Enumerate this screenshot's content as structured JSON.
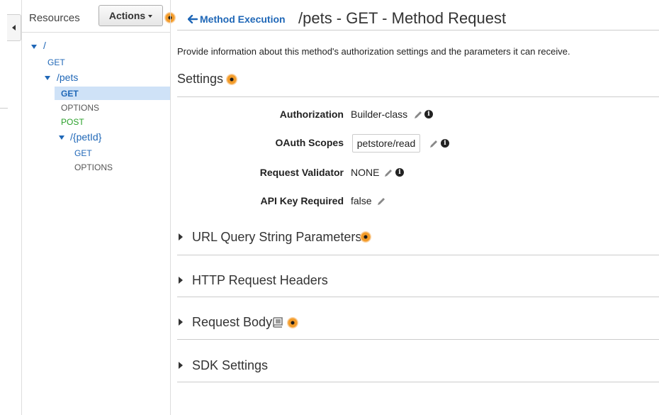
{
  "resources": {
    "title": "Resources",
    "actions_label": "Actions",
    "tree": {
      "root_path": "/",
      "root_get": "GET",
      "pets_path": "/pets",
      "pets_get": "GET",
      "pets_options": "OPTIONS",
      "pets_post": "POST",
      "petid_path": "/{petId}",
      "petid_get": "GET",
      "petid_options": "OPTIONS"
    }
  },
  "header": {
    "back_link": "Method Execution",
    "title": "/pets - GET - Method Request"
  },
  "description": "Provide information about this method's authorization settings and the parameters it can receive.",
  "settings": {
    "heading": "Settings",
    "authorization_label": "Authorization",
    "authorization_value": "Builder-class",
    "oauth_label": "OAuth Scopes",
    "oauth_value": "petstore/read",
    "validator_label": "Request Validator",
    "validator_value": "NONE",
    "api_key_label": "API Key Required",
    "api_key_value": "false"
  },
  "sections": {
    "query_params": "URL Query String Parameters",
    "http_headers": "HTTP Request Headers",
    "request_body": "Request Body",
    "sdk_settings": "SDK Settings"
  },
  "icons": {
    "help": "help-dot-icon",
    "edit": "pencil-icon",
    "info": "info-icon",
    "book": "book-icon",
    "back": "arrow-left-icon"
  },
  "colors": {
    "link": "#1f67b7",
    "post": "#2aa02a",
    "selected_bg": "#cfe2f7",
    "help_accent": "#f39c2a"
  }
}
